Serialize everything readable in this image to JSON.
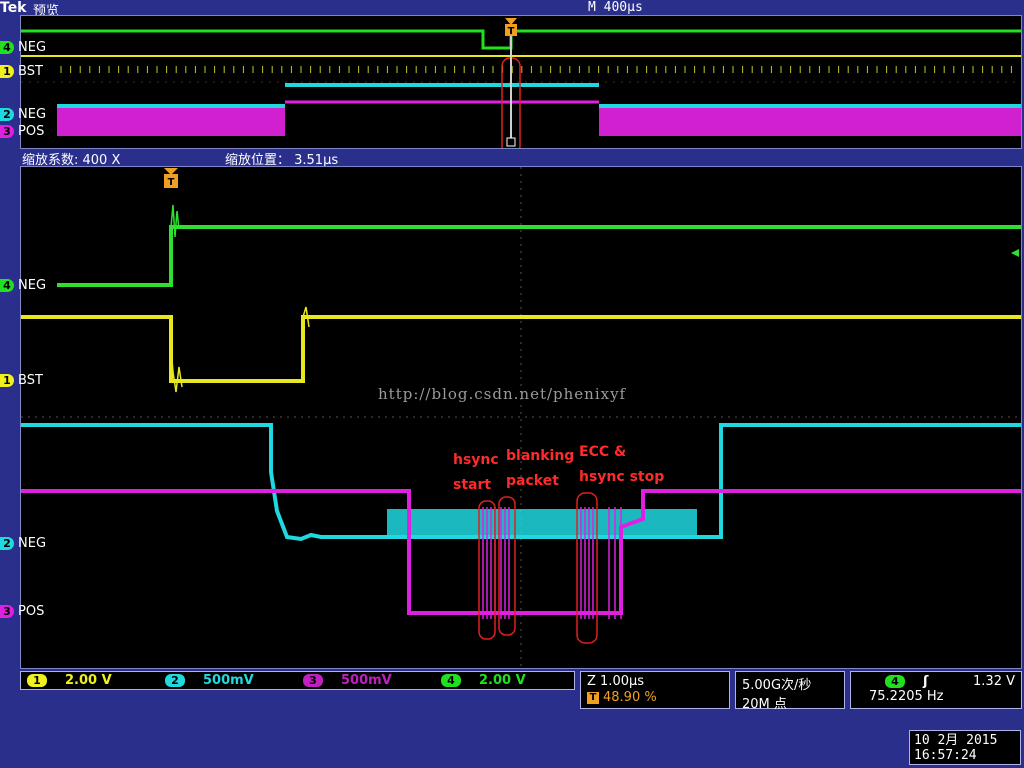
{
  "header": {
    "brand": "Tek",
    "mode": "预览",
    "timebase": "M 400µs"
  },
  "overview": {
    "channels": [
      {
        "num": "4",
        "label": "NEG",
        "color": "#20e020"
      },
      {
        "num": "1",
        "label": "BST",
        "color": "#f0f020"
      },
      {
        "num": "2",
        "label": "NEG",
        "color": "#20d8e0"
      },
      {
        "num": "3",
        "label": "POS",
        "color": "#e020e0"
      }
    ]
  },
  "zoom_info": {
    "factor": "缩放系数: 400 X",
    "position": "缩放位置： 3.51µs"
  },
  "zoom": {
    "channels": [
      {
        "num": "4",
        "label": "NEG",
        "color": "#20e020"
      },
      {
        "num": "1",
        "label": "BST",
        "color": "#f0f020"
      },
      {
        "num": "2",
        "label": "NEG",
        "color": "#20d8e0"
      },
      {
        "num": "3",
        "label": "POS",
        "color": "#e020e0"
      }
    ],
    "watermark": "http://blog.csdn.net/phenixyf",
    "annotations": {
      "hsync1": "hsync",
      "hsync2": "start",
      "blank1": "blanking",
      "blank2": "packet",
      "ecc1": "ECC &",
      "ecc2": "hsync stop"
    }
  },
  "scales": [
    {
      "num": "1",
      "value": "2.00 V",
      "color": "#f0f020"
    },
    {
      "num": "2",
      "value": "500mV",
      "color": "#20d8e0"
    },
    {
      "num": "3",
      "value": "500mV",
      "color": "#c020c0"
    },
    {
      "num": "4",
      "value": "2.00 V",
      "color": "#20e020"
    }
  ],
  "horizontal": {
    "zoom_scale": "Z 1.00µs",
    "trigger_pos": "48.90 %"
  },
  "acquisition": {
    "rate": "5.00G次/秒",
    "points": "20M 点"
  },
  "trigger": {
    "channel": "4",
    "level": "1.32 V",
    "freq": "75.2205 Hz"
  },
  "datetime": {
    "date": "10 2月 2015",
    "time": "16:57:24"
  }
}
